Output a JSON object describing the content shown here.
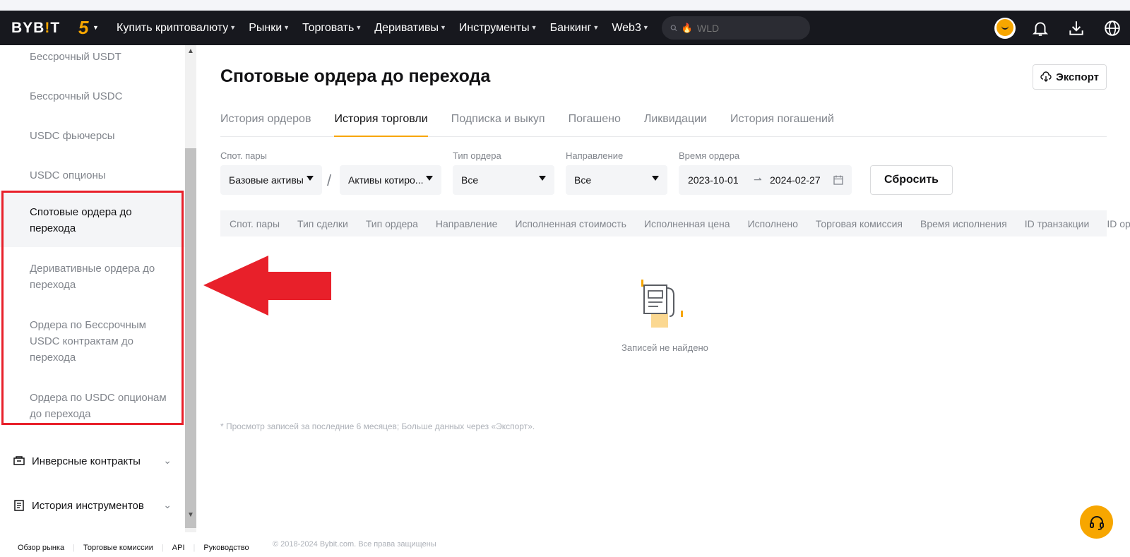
{
  "nav": {
    "logo_a": "BYB",
    "logo_bang": "!",
    "logo_b": "T",
    "five_badge": "5",
    "menu": [
      "Купить криптовалюту",
      "Рынки",
      "Торговать",
      "Деривативы",
      "Инструменты",
      "Банкинг",
      "Web3"
    ],
    "search_placeholder": "WLD"
  },
  "sidebar": {
    "items": [
      "Бессрочный USDT",
      "Бессрочный USDC",
      "USDC фьючерсы",
      "USDC опционы",
      "Спотовые ордера до перехода",
      "Деривативные ордера до перехода",
      "Ордера по Бессрочным USDC контрактам до перехода",
      "Ордера по USDC опционам до перехода"
    ],
    "groups": [
      "Инверсные контракты",
      "История инструментов"
    ]
  },
  "main": {
    "title": "Спотовые ордера до перехода",
    "export_label": "Экспорт",
    "tabs": [
      "История ордеров",
      "История торговли",
      "Подписка и выкуп",
      "Погашено",
      "Ликвидации",
      "История погашений"
    ],
    "filters": {
      "pairs_label": "Спот. пары",
      "base_assets": "Базовые активы",
      "quote_assets": "Активы котиро...",
      "order_type_label": "Тип ордера",
      "order_type_value": "Все",
      "direction_label": "Направление",
      "direction_value": "Все",
      "time_label": "Время ордера",
      "date_from": "2023-10-01",
      "date_to": "2024-02-27",
      "reset_label": "Сбросить"
    },
    "columns": [
      "Спот. пары",
      "Тип сделки",
      "Тип ордера",
      "Направление",
      "Исполненная стоимость",
      "Исполненная цена",
      "Исполнено",
      "Торговая комиссия",
      "Время исполнения",
      "ID транзакции",
      "ID ордера"
    ],
    "empty_text": "Записей не найдено",
    "note": "* Просмотр записей за последние 6 месяцев; Больше данных через «Экспорт»."
  },
  "footer": {
    "links": [
      "Обзор рынка",
      "Торговые комиссии",
      "API",
      "Руководство"
    ],
    "copyright": "© 2018-2024 Bybit.com. Все права защищены"
  },
  "colors": {
    "brand": "#f7a600",
    "navbar": "#17181e",
    "annotation_red": "#e8202a"
  }
}
